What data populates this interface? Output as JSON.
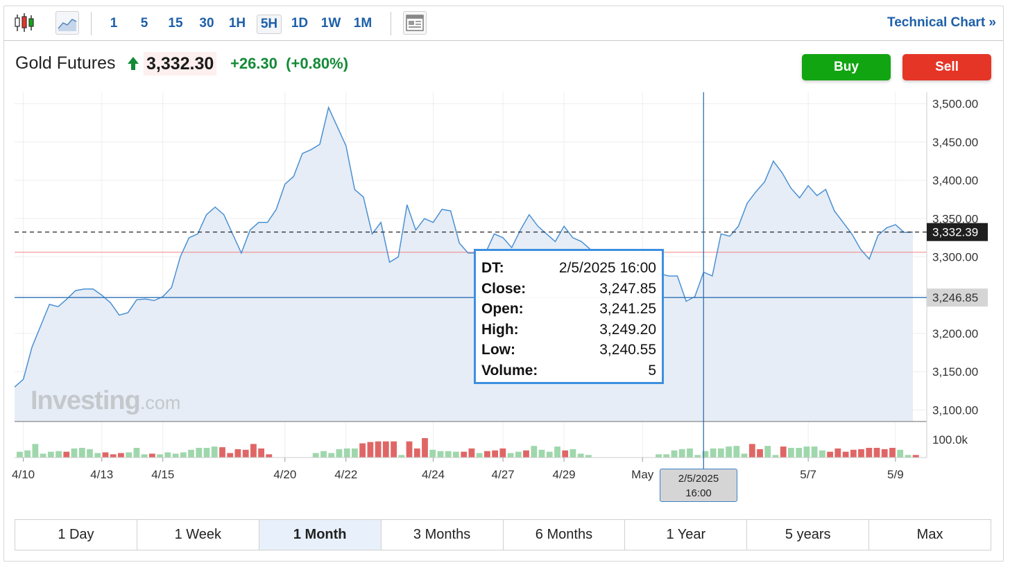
{
  "toolbar": {
    "timeframes": [
      "1",
      "5",
      "15",
      "30",
      "1H",
      "5H",
      "1D",
      "1W",
      "1M"
    ],
    "active_timeframe": "5H",
    "technical_link": "Technical Chart »"
  },
  "header": {
    "instrument": "Gold Futures",
    "price": "3,332.30",
    "change": "+26.30",
    "change_pct": "(+0.80%)",
    "buy_label": "Buy",
    "sell_label": "Sell"
  },
  "colors": {
    "line": "#4a90d2",
    "area": "#e6edf6",
    "buy": "#12a512",
    "sell": "#e43527",
    "volume_up": "#9fd7ac",
    "volume_down": "#e06666",
    "change_positive": "#138a36"
  },
  "chart_data": {
    "type": "area",
    "xlabel": "",
    "ylabel": "",
    "ylim": [
      3085,
      3515
    ],
    "yticks": [
      3100,
      3150,
      3200,
      3250,
      3300,
      3350,
      3400,
      3450,
      3500
    ],
    "ytick_labels": [
      "3,100.00",
      "3,150.00",
      "3,200.00",
      "3,250.00",
      "3,300.00",
      "3,350.00",
      "3,400.00",
      "3,450.00",
      "3,500.00"
    ],
    "xtick_labels": [
      {
        "label": "4/10",
        "x": 1
      },
      {
        "label": "4/13",
        "x": 10
      },
      {
        "label": "4/15",
        "x": 17
      },
      {
        "label": "4/20",
        "x": 31
      },
      {
        "label": "4/22",
        "x": 38
      },
      {
        "label": "4/24",
        "x": 48
      },
      {
        "label": "4/27",
        "x": 56
      },
      {
        "label": "4/29",
        "x": 63
      },
      {
        "label": "May",
        "x": 72
      },
      {
        "label": "5/7",
        "x": 91
      },
      {
        "label": "5/9",
        "x": 101
      }
    ],
    "series": [
      {
        "values": [
          3130,
          3140,
          3182,
          3210,
          3238,
          3235,
          3245,
          3256,
          3258,
          3258,
          3250,
          3240,
          3224,
          3227,
          3244,
          3245,
          3243,
          3248,
          3260,
          3300,
          3325,
          3330,
          3355,
          3365,
          3355,
          3330,
          3305,
          3335,
          3345,
          3345,
          3362,
          3395,
          3405,
          3435,
          3440,
          3447,
          3495,
          3470,
          3445,
          3388,
          3378,
          3330,
          3345,
          3293,
          3300,
          3368,
          3335,
          3350,
          3345,
          3362,
          3360,
          3318,
          3305,
          3305,
          3305,
          3330,
          3325,
          3312,
          3335,
          3355,
          3340,
          3330,
          3320,
          3340,
          3325,
          3320,
          3310,
          3305,
          3300,
          3295,
          3290,
          3300,
          3305,
          3282,
          3278,
          3275,
          3275,
          3242,
          3248,
          3280,
          3275,
          3330,
          3327,
          3340,
          3370,
          3385,
          3398,
          3425,
          3410,
          3390,
          3377,
          3393,
          3380,
          3388,
          3360,
          3345,
          3330,
          3310,
          3297,
          3328,
          3338,
          3342,
          3332,
          3332.3
        ]
      }
    ],
    "volume_ticks": [
      "100.0k"
    ],
    "volume": {
      "values": [
        18,
        22,
        42,
        12,
        18,
        20,
        18,
        28,
        30,
        26,
        14,
        16,
        10,
        14,
        16,
        30,
        10,
        12,
        10,
        16,
        12,
        16,
        24,
        30,
        30,
        34,
        32,
        14,
        26,
        24,
        42,
        28,
        10,
        0,
        0,
        0,
        0,
        0,
        14,
        20,
        14,
        26,
        28,
        28,
        44,
        48,
        50,
        50,
        50,
        8,
        50,
        28,
        60,
        24,
        20,
        20,
        18,
        18,
        28,
        14,
        20,
        22,
        28,
        14,
        18,
        22,
        36,
        24,
        18,
        34,
        22,
        26,
        12,
        8,
        0,
        0,
        0,
        0,
        0,
        0,
        0,
        0,
        10,
        10,
        22,
        26,
        28,
        8,
        20,
        28,
        28,
        34,
        36,
        12,
        42,
        26,
        36,
        8,
        34,
        30,
        30,
        34,
        34,
        22,
        18,
        28,
        18,
        24,
        26,
        30,
        30,
        26,
        30,
        24,
        8,
        8
      ],
      "up": [
        1,
        1,
        1,
        1,
        1,
        1,
        0,
        1,
        1,
        1,
        1,
        0,
        0,
        0,
        1,
        1,
        1,
        0,
        1,
        1,
        1,
        1,
        1,
        1,
        1,
        1,
        0,
        0,
        0,
        0,
        0,
        0,
        0,
        0,
        0,
        0,
        0,
        0,
        1,
        1,
        1,
        1,
        1,
        1,
        0,
        0,
        0,
        0,
        0,
        1,
        0,
        0,
        0,
        1,
        1,
        1,
        1,
        0,
        0,
        1,
        0,
        0,
        0,
        1,
        1,
        0,
        1,
        1,
        1,
        1,
        0,
        1,
        1,
        1,
        0,
        0,
        0,
        0,
        0,
        0,
        0,
        0,
        1,
        1,
        1,
        1,
        1,
        1,
        1,
        1,
        1,
        1,
        1,
        1,
        0,
        0,
        1,
        1,
        0,
        1,
        1,
        1,
        1,
        1,
        0,
        0,
        0,
        0,
        0,
        0,
        0,
        0,
        0,
        1,
        1,
        0
      ]
    },
    "last_price_line": {
      "label": "3,332.39",
      "value": 3332.39
    },
    "reference_line": {
      "value": 3306
    },
    "crosshair": {
      "x_label": "2/5/2025\n16:00",
      "y_label": "3,246.85",
      "value": 3246.85,
      "x": 79
    }
  },
  "tooltip": {
    "rows": [
      {
        "k": "DT:",
        "v": "2/5/2025 16:00"
      },
      {
        "k": "Close:",
        "v": "3,247.85"
      },
      {
        "k": "Open:",
        "v": "3,241.25"
      },
      {
        "k": "High:",
        "v": "3,249.20"
      },
      {
        "k": "Low:",
        "v": "3,240.55"
      },
      {
        "k": "Volume:",
        "v": "5"
      }
    ]
  },
  "crosshair_label": {
    "line1": "2/5/2025",
    "line2": "16:00"
  },
  "watermark": {
    "brand": "Investing",
    "suffix": ".com"
  },
  "periods": [
    "1 Day",
    "1 Week",
    "1 Month",
    "3 Months",
    "6 Months",
    "1 Year",
    "5 years",
    "Max"
  ],
  "active_period": "1 Month"
}
